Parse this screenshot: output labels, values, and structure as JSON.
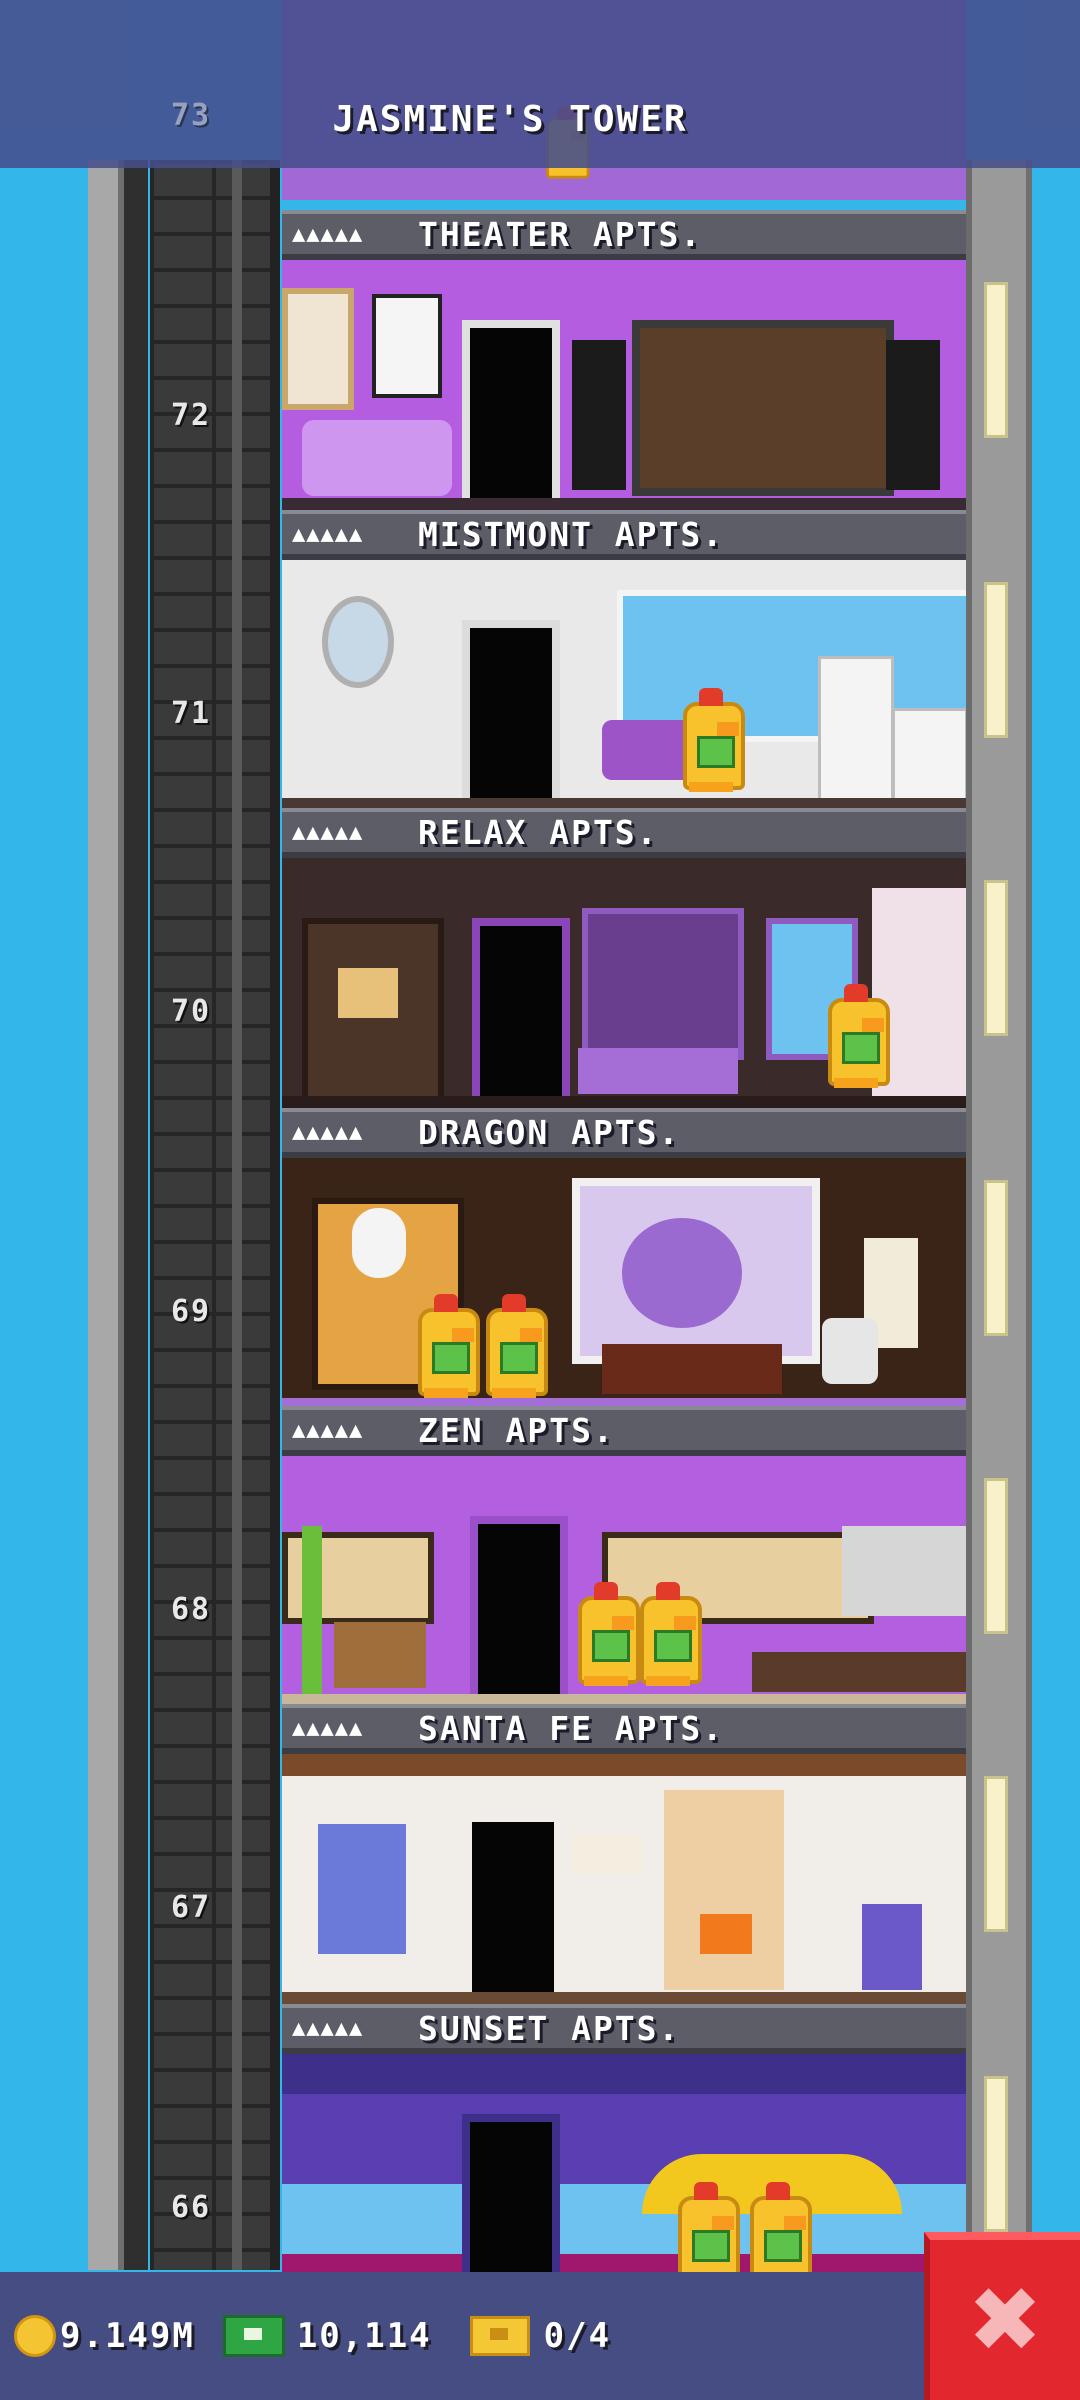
{
  "tower": {
    "title": "JASMINE'S TOWER",
    "top_floor_number": "73"
  },
  "floors": [
    {
      "number": "72",
      "name": "THEATER APTS.",
      "stars": "▲▲▲▲▲"
    },
    {
      "number": "71",
      "name": "MISTMONT APTS.",
      "stars": "▲▲▲▲▲"
    },
    {
      "number": "70",
      "name": "RELAX APTS.",
      "stars": "▲▲▲▲▲"
    },
    {
      "number": "69",
      "name": "DRAGON APTS.",
      "stars": "▲▲▲▲▲"
    },
    {
      "number": "68",
      "name": "ZEN APTS.",
      "stars": "▲▲▲▲▲"
    },
    {
      "number": "67",
      "name": "SANTA FE APTS.",
      "stars": "▲▲▲▲▲"
    },
    {
      "number": "66",
      "name": "SUNSET APTS.",
      "stars": "▲▲▲▲▲"
    }
  ],
  "status": {
    "coins": "9.149M",
    "bux": "10,114",
    "vip": "0/4",
    "close_label": "✖"
  },
  "colors": {
    "sky": "#33b7ea",
    "title_bar": "#464e8c",
    "close_button": "#e2272e",
    "theater_wall": "#b45de0",
    "mistmont_wall": "#e9e9e9",
    "relax_wall": "#3a2a2a",
    "dragon_wall": "#3a2418",
    "zen_wall": "#b25fe0",
    "santafe_wall": "#f1eeea",
    "sunset_wall": "#5a3fb3"
  },
  "icons": [
    "coin-icon",
    "bux-icon",
    "vip-ticket-icon",
    "close-icon"
  ]
}
